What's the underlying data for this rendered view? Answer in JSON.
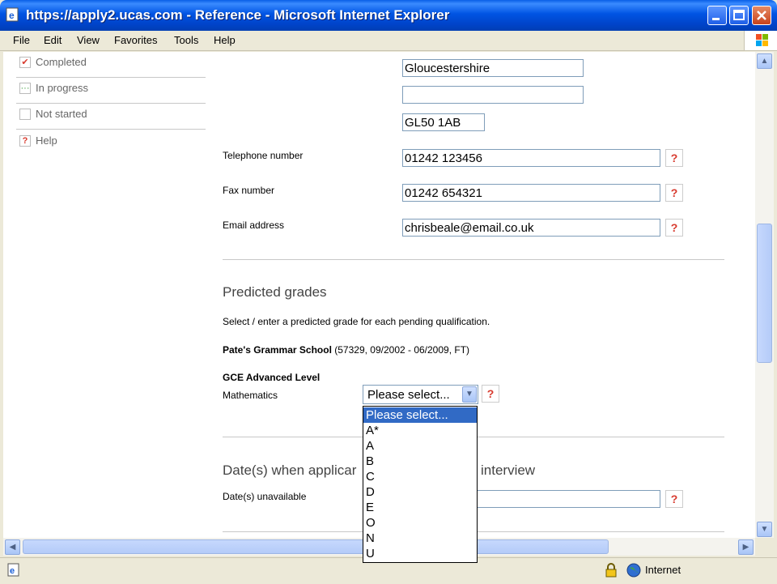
{
  "window": {
    "title": "https://apply2.ucas.com - Reference - Microsoft Internet Explorer"
  },
  "menu": [
    "File",
    "Edit",
    "View",
    "Favorites",
    "Tools",
    "Help"
  ],
  "legend": [
    {
      "label": "Completed",
      "mark": "✔",
      "color": "#d83a2e"
    },
    {
      "label": "In progress",
      "mark": "···",
      "color": "#3a9a3a"
    },
    {
      "label": "Not started",
      "mark": "",
      "color": "#999999"
    },
    {
      "label": "Help",
      "mark": "?",
      "color": "#d83a2e"
    }
  ],
  "address": {
    "county": "Gloucestershire",
    "line_blank": "",
    "postcode": "GL50 1AB"
  },
  "contact": {
    "telephone_label": "Telephone number",
    "telephone_value": "01242 123456",
    "fax_label": "Fax number",
    "fax_value": "01242 654321",
    "email_label": "Email address",
    "email_value": "chrisbeale@email.co.uk"
  },
  "predicted": {
    "heading": "Predicted grades",
    "instruction": "Select / enter a predicted grade for each pending qualification.",
    "school_name": "Pate's Grammar School",
    "school_details": "(57329, 09/2002 - 06/2009, FT)",
    "qualification": "GCE Advanced Level",
    "subject": "Mathematics",
    "selected": "Please select...",
    "options": [
      "Please select...",
      "A*",
      "A",
      "B",
      "C",
      "D",
      "E",
      "O",
      "N",
      "U"
    ]
  },
  "dates": {
    "heading_left": "Date(s) when applicar",
    "heading_right": "interview",
    "unavailable_label": "Date(s) unavailable"
  },
  "help_mark": "?",
  "status": {
    "zone": "Internet"
  }
}
